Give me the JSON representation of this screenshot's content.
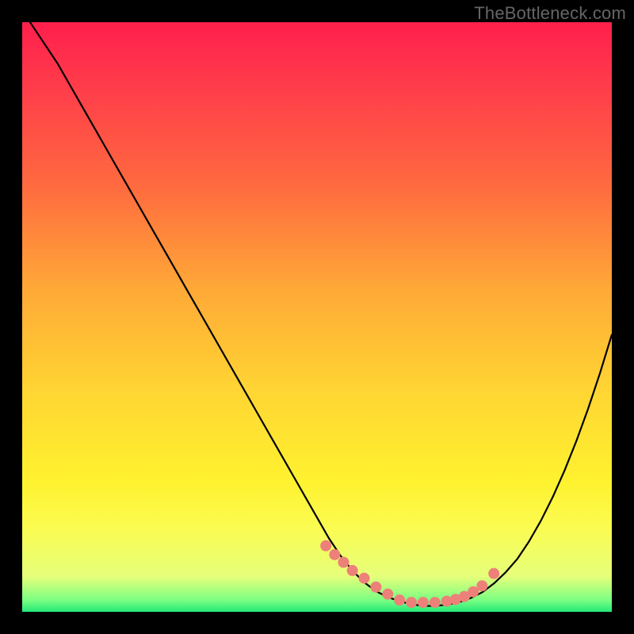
{
  "watermark": "TheBottleneck.com",
  "chart_data": {
    "type": "line",
    "title": "",
    "xlabel": "",
    "ylabel": "",
    "xlim": [
      0,
      100
    ],
    "ylim": [
      0,
      100
    ],
    "grid": false,
    "x": [
      0,
      2,
      4,
      6,
      8,
      10,
      12,
      14,
      16,
      18,
      20,
      22,
      24,
      26,
      28,
      30,
      32,
      34,
      36,
      38,
      40,
      42,
      44,
      46,
      48,
      50,
      52,
      54,
      56,
      58,
      60,
      62,
      64,
      66,
      68,
      70,
      72,
      74,
      76,
      78,
      80,
      82,
      84,
      86,
      88,
      90,
      92,
      94,
      96,
      98,
      100
    ],
    "y": [
      102,
      99,
      96,
      93,
      89.5,
      86,
      82.5,
      79,
      75.5,
      72,
      68.5,
      65,
      61.5,
      58,
      54.5,
      51,
      47.5,
      44,
      40.5,
      37,
      33.5,
      30,
      26.5,
      23,
      19.5,
      16,
      12.5,
      9.5,
      7,
      5,
      3.5,
      2.5,
      1.8,
      1.3,
      1,
      1,
      1.2,
      1.6,
      2.3,
      3.3,
      4.8,
      6.7,
      9,
      12,
      15.5,
      19.5,
      24,
      29,
      34.5,
      40.5,
      47
    ],
    "series": [
      {
        "name": "bottleneck-curve",
        "type": "line",
        "color": "#000000",
        "stroke_width": 2
      },
      {
        "name": "near-optimum-markers",
        "type": "scatter",
        "color": "#ed8079",
        "marker_radius": 7,
        "points_x": [
          51.5,
          53,
          54.5,
          56,
          60,
          64,
          58,
          62,
          66,
          68,
          70,
          72,
          73.5,
          75,
          76.5,
          78,
          80
        ],
        "points_y": [
          11.2,
          9.7,
          8.4,
          7,
          4.2,
          2,
          5.7,
          3,
          1.6,
          1.6,
          1.6,
          1.8,
          2.1,
          2.6,
          3.4,
          4.4,
          6.5
        ]
      }
    ],
    "gradient_stops": [
      {
        "pos": 0.0,
        "color": "#ff1f4c"
      },
      {
        "pos": 0.12,
        "color": "#ff3f4a"
      },
      {
        "pos": 0.28,
        "color": "#ff6b3f"
      },
      {
        "pos": 0.45,
        "color": "#ffa837"
      },
      {
        "pos": 0.62,
        "color": "#ffd433"
      },
      {
        "pos": 0.78,
        "color": "#fff22f"
      },
      {
        "pos": 0.86,
        "color": "#fafc52"
      },
      {
        "pos": 0.94,
        "color": "#e6ff7a"
      },
      {
        "pos": 0.98,
        "color": "#7bff82"
      },
      {
        "pos": 1.0,
        "color": "#23e97a"
      }
    ]
  }
}
